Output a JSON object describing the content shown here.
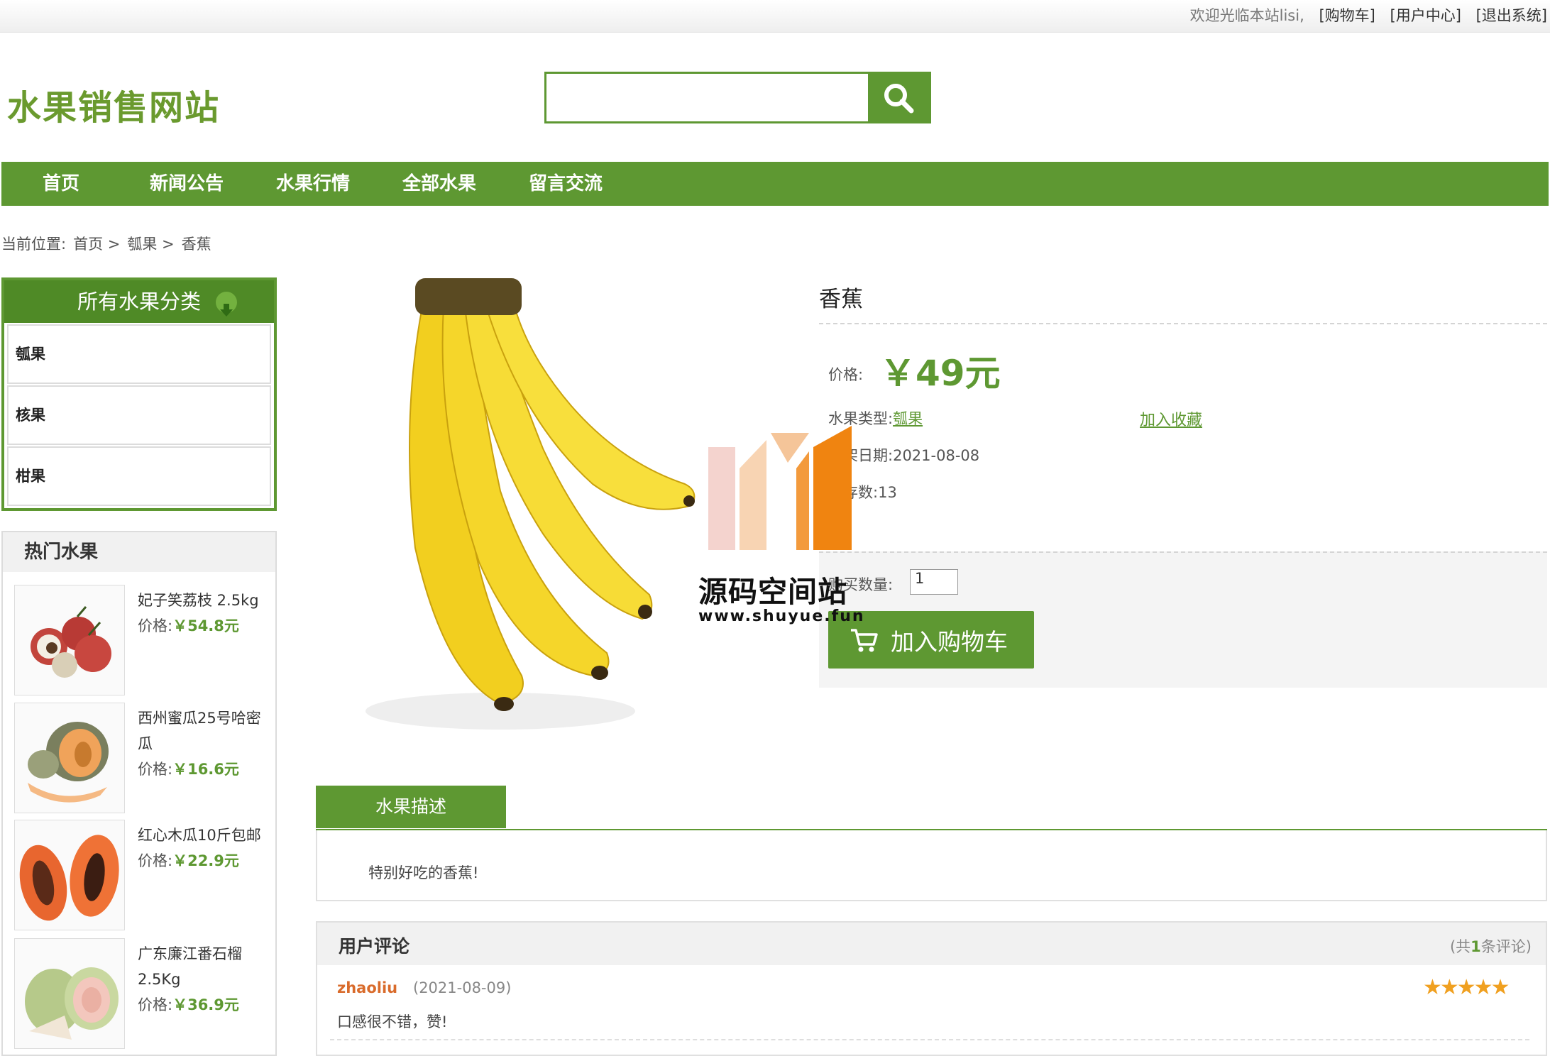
{
  "topbar": {
    "welcome": "欢迎光临本站lisi,",
    "cart": "[购物车]",
    "user_center": "[用户中心]",
    "logout": "[退出系统]"
  },
  "site": {
    "title": "水果销售网站"
  },
  "search": {
    "value": "",
    "placeholder": ""
  },
  "nav": [
    "首页",
    "新闻公告",
    "水果行情",
    "全部水果",
    "留言交流"
  ],
  "breadcrumb": {
    "prefix": "当前位置:",
    "items": [
      "首页 >",
      "瓠果 >",
      "香蕉"
    ]
  },
  "categories": {
    "title": "所有水果分类",
    "items": [
      "瓠果",
      "核果",
      "柑果"
    ]
  },
  "hot": {
    "title": "热门水果",
    "price_label": "价格:",
    "items": [
      {
        "name": "妃子笑荔枝 2.5kg",
        "price": "￥54.8元"
      },
      {
        "name": "西州蜜瓜25号哈密瓜",
        "price": "￥16.6元"
      },
      {
        "name": "红心木瓜10斤包邮",
        "price": "￥22.9元"
      },
      {
        "name": "广东廉江番石榴2.5Kg",
        "price": "￥36.9元"
      }
    ]
  },
  "product": {
    "name": "香蕉",
    "price_label": "价格:",
    "price": "￥49元",
    "type_label": "水果类型:",
    "type": "瓠果",
    "favorite": "加入收藏",
    "date_label": "上架日期:",
    "date": "2021-08-08",
    "stock_label": "库存数:",
    "stock": "13",
    "qty_label": "购买数量:",
    "qty": "1",
    "add_cart": "加入购物车"
  },
  "watermark": {
    "name": "源码空间站",
    "url": "www.shuyue.fun"
  },
  "description": {
    "tab": "水果描述",
    "text": "特别好吃的香蕉!"
  },
  "reviews": {
    "title": "用户评论",
    "count_prefix": "(共",
    "count": "1",
    "count_suffix": "条评论)",
    "items": [
      {
        "user": "zhaoliu",
        "date": "(2021-08-09)",
        "text": "口感很不错，赞!",
        "stars": "★★★★★"
      }
    ]
  },
  "colors": {
    "accent": "#5e9832",
    "price": "#5e9832",
    "reviewer": "#d96b2b",
    "stars": "#f0a020"
  }
}
